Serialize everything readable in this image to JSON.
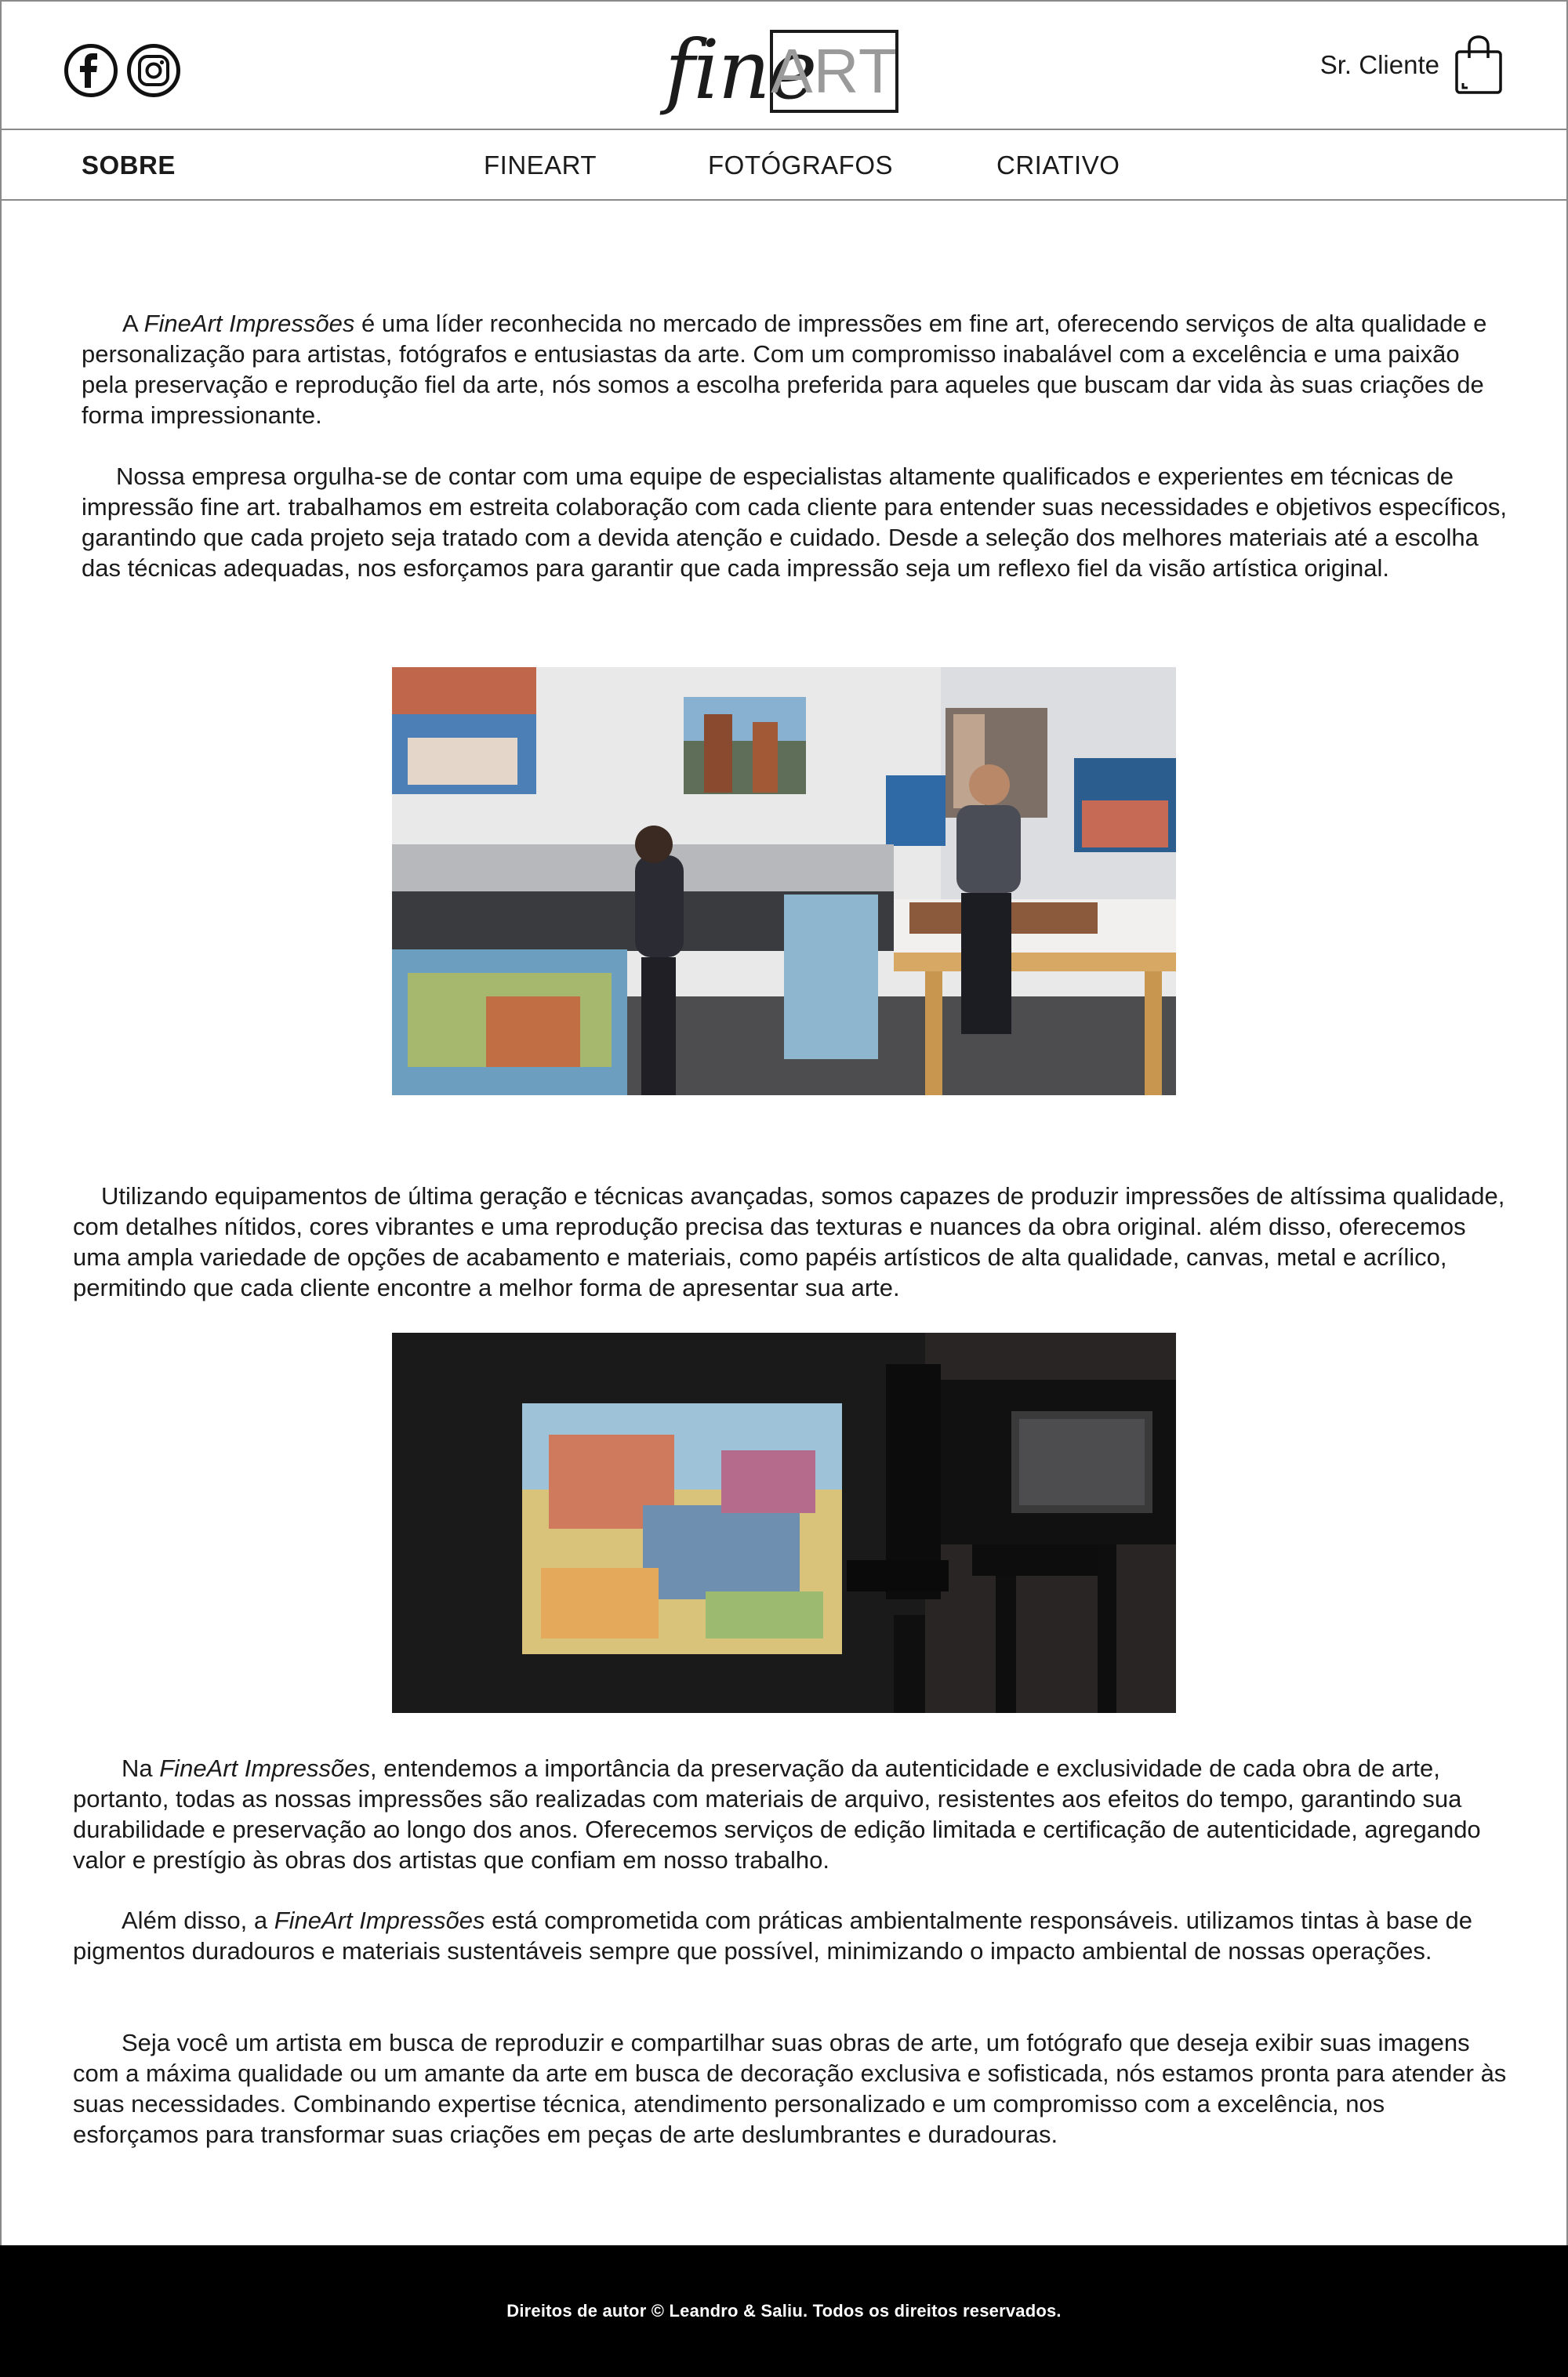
{
  "header": {
    "logo_script": "fine",
    "logo_box": "ART",
    "account_label": "Sr. Cliente"
  },
  "nav": {
    "items": [
      {
        "label": "SOBRE"
      },
      {
        "label": "FINEART"
      },
      {
        "label": "FOTÓGRAFOS"
      },
      {
        "label": "CRIATIVO"
      }
    ]
  },
  "content": {
    "p1": {
      "lead": "A ",
      "brand": "FineArt Impressões",
      "rest": " é uma líder reconhecida no mercado de impressões em fine art, oferecendo serviços de alta qualidade e personalização para artistas, fotógrafos e entusiastas da arte. Com um compromisso inabalável com a excelência e uma paixão pela preservação e reprodução fiel da arte, nós somos a escolha preferida para aqueles que buscam dar vida às suas criações de forma impressionante."
    },
    "p2": "Nossa empresa orgulha-se de contar com uma equipe de especialistas altamente qualificados e experientes em técnicas de impressão fine art. trabalhamos em estreita colaboração com cada cliente para entender suas necessidades e objetivos específicos, garantindo que cada projeto seja tratado com a devida atenção e cuidado. Desde a seleção dos melhores materiais até a escolha das técnicas adequadas, nos esforçamos para garantir que cada impressão seja um reflexo fiel da visão artística original.",
    "p3": "Utilizando equipamentos de última geração e técnicas avançadas, somos capazes de produzir impressões de altíssima qualidade, com detalhes nítidos, cores vibrantes e uma reprodução precisa das texturas e nuances da obra original. além disso, oferecemos uma ampla variedade de opções de acabamento e materiais, como papéis artísticos de alta qualidade, canvas, metal e acrílico, permitindo que cada cliente encontre a melhor forma de apresentar sua arte.",
    "p4": {
      "lead": "Na ",
      "brand": "FineArt Impressões",
      "rest": ", entendemos a importância da preservação da autenticidade e exclusividade de cada obra de arte, portanto, todas as nossas impressões são realizadas com materiais de arquivo, resistentes aos efeitos do tempo, garantindo sua durabilidade e preservação ao longo dos anos. Oferecemos serviços de edição limitada e certificação de autenticidade, agregando valor e prestígio às obras dos artistas que confiam em nosso trabalho."
    },
    "p5": {
      "lead": "Além disso, a ",
      "brand": "FineArt Impressões",
      "rest": " está comprometida com práticas ambientalmente responsáveis. utilizamos tintas à base de pigmentos duradouros e materiais sustentáveis sempre que possível, minimizando o impacto ambiental de nossas operações."
    },
    "p6": "Seja você um artista em busca de reproduzir e compartilhar suas obras de arte, um fotógrafo que deseja exibir suas imagens com a máxima qualidade ou um amante da arte em busca de decoração exclusiva e sofisticada, nós estamos pronta para atender às suas necessidades. Combinando expertise técnica, atendimento personalizado e um compromisso com a excelência, nos esforçamos para transformar suas criações em peças de arte deslumbrantes e duradouras."
  },
  "footer": {
    "text": "Direitos de autor © Leandro & Saliu. Todos os direitos reservados."
  },
  "icons": [
    "facebook-icon",
    "instagram-icon",
    "shopping-bag-icon"
  ],
  "colors": {
    "border": "#8a8a8a",
    "text": "#1a1a1a",
    "logo_box_text": "#9a9a9a",
    "footer_bg": "#000000",
    "footer_text": "#ffffff"
  }
}
